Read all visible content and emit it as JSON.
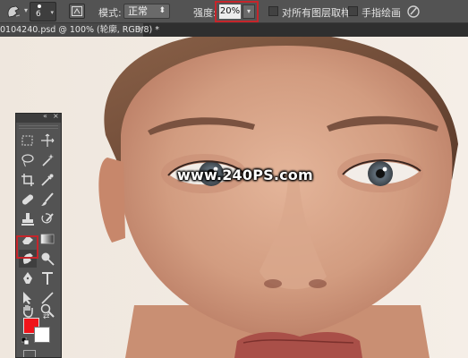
{
  "options_bar": {
    "brush_size": "6",
    "mode_label": "模式:",
    "mode_value": "正常",
    "strength_label": "强度:",
    "strength_value": "20%",
    "sample_all_layers_label": "对所有图层取样",
    "sample_all_layers_checked": false,
    "finger_painting_label": "手指绘画",
    "finger_painting_checked": false
  },
  "document_tab": {
    "title": "0104240.psd @ 100% (轮廓, RGB/8) *",
    "close_glyph": "×"
  },
  "canvas": {
    "watermark": "www.240PS.com"
  },
  "tools_panel": {
    "collapse_glyph": "«",
    "close_glyph": "×",
    "active_tool": "smudge-tool",
    "foreground_color": "#f0141a",
    "background_color": "#ffffff",
    "highlight_color": "#c6252b"
  }
}
